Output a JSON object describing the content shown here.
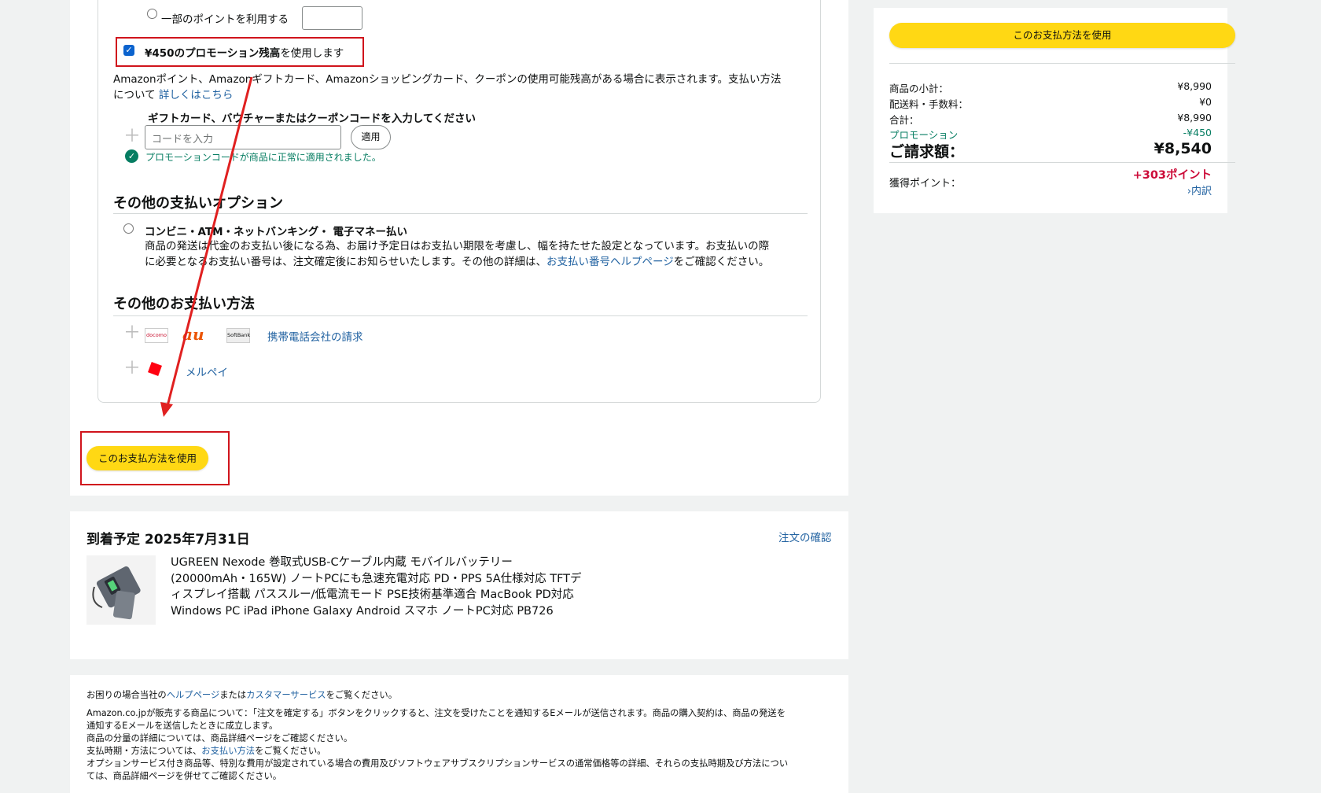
{
  "payment": {
    "partial_points_label": "一部のポイントを利用する",
    "promo_balance_label_bold": "¥450のプロモーション残高",
    "promo_balance_label_rest": "を使用します",
    "balance_note": "Amazonポイント、Amazonギフトカード、Amazonショッピングカード、クーポンの使用可能残高がある場合に表示されます。支払い方法",
    "balance_note_line2": "について",
    "learn_more": "詳しくはこちら",
    "gift_title": "ギフトカード、バウチャーまたはクーポンコードを入力してください",
    "code_placeholder": "コードを入力",
    "apply_button": "適用",
    "success_message": "プロモーションコードが商品に正常に適用されました。"
  },
  "other_options": {
    "title": "その他の支払いオプション",
    "convenience_label": "コンビニ・ATM・ネットバンキング・ 電子マネー払い",
    "convenience_desc_1": "商品の発送は代金のお支払い後になる為、お届け予定日はお支払い期限を考慮し、幅を持たせた設定となっています。お支払いの際",
    "convenience_desc_2a": "に必要となるお支払い番号は、注文確定後にお知らせいたします。その他の詳細は、",
    "convenience_desc_link": "お支払い番号ヘルプページ",
    "convenience_desc_2b": "をご確認ください。"
  },
  "other_methods": {
    "title": "その他のお支払い方法",
    "carrier_link": "携帯電話会社の請求",
    "docomo_logo": "docomo",
    "au_logo": "au",
    "softbank_logo": "SoftBank",
    "merpay_link": "メルペイ"
  },
  "use_method_button": "このお支払方法を使用",
  "delivery": {
    "title": "到着予定 2025年7月31日",
    "review_link": "注文の確認",
    "product_lines": [
      "UGREEN Nexode 巻取式USB-Cケーブル内蔵 モバイルバッテリー",
      "(20000mAh・165W) ノートPCにも急速充電対応 PD・PPS 5A仕様対応 TFTデ",
      "ィスプレイ搭載 パススルー/低電流モード PSE技術基準適合 MacBook PD対応",
      "Windows PC iPad iPhone Galaxy Android スマホ ノートPC対応 PB726"
    ]
  },
  "legal": {
    "line1_a": "お困りの場合当社の",
    "line1_help": "ヘルプページ",
    "line1_b": "または",
    "line1_cs": "カスタマーサービス",
    "line1_c": "をご覧ください。",
    "line2": "Amazon.co.jpが販売する商品について：「注文を確定する」ボタンをクリックすると、注文を受けたことを通知するEメールが送信されます。商品の購入契約は、商品の発送を",
    "line3": "通知するEメールを送信したときに成立します。",
    "line4": "商品の分量の詳細については、商品詳細ページをご確認ください。",
    "line5_a": "支払時期・方法については、",
    "line5_link": "お支払い方法",
    "line5_b": "をご覧ください。",
    "line6": "オプションサービス付き商品等、特別な費用が設定されている場合の費用及びソフトウェアサブスクリプションサービスの通常価格等の詳細、それらの支払時期及び方法につい",
    "line7": "ては、商品詳細ページを併せてご確認ください。"
  },
  "summary": {
    "button": "このお支払方法を使用",
    "subtotal_label": "商品の小計：",
    "subtotal_value": "¥8,990",
    "shipping_label": "配送料・手数料：",
    "shipping_value": "¥0",
    "total_label": "合計：",
    "total_value": "¥8,990",
    "promo_label": "プロモーション",
    "promo_value": "-¥450",
    "grand_label": "ご請求額：",
    "grand_value": "¥8,540",
    "points_label": "獲得ポイント：",
    "points_value": "+303ポイント",
    "breakdown_link": "›内訳"
  },
  "colors": {
    "accent_yellow": "#ffd814",
    "link_blue": "#2162a1",
    "promo_green": "#067d62",
    "points_red": "#cc0c39",
    "annotation_red": "#d0141c"
  }
}
